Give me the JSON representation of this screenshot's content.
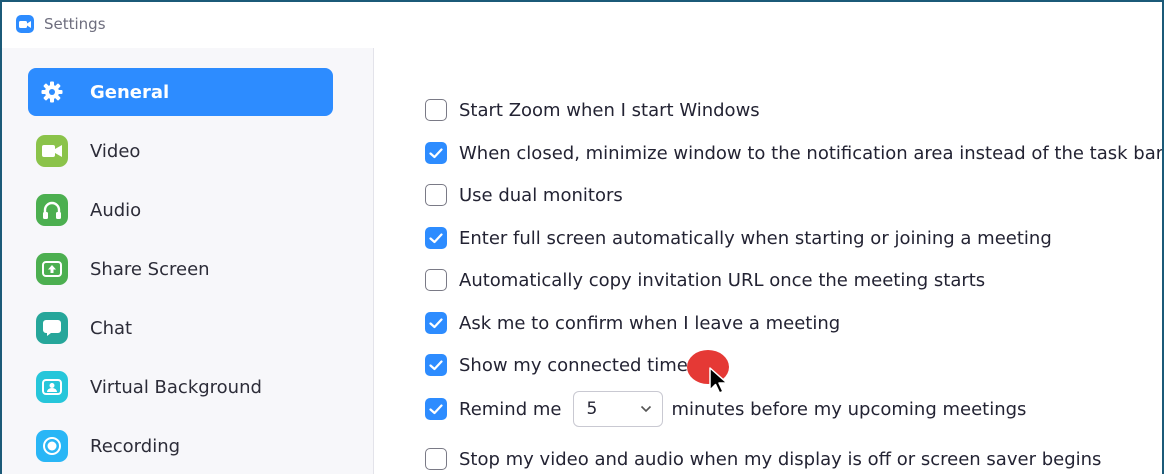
{
  "window": {
    "title": "Settings",
    "icon": "zoom-camera-icon"
  },
  "sidebar": {
    "items": [
      {
        "label": "General",
        "icon": "gear-icon",
        "active": true,
        "color": "#ffffff"
      },
      {
        "label": "Video",
        "icon": "video-camera-icon",
        "color": "#8bc34a"
      },
      {
        "label": "Audio",
        "icon": "headphones-icon",
        "color": "#4caf50"
      },
      {
        "label": "Share Screen",
        "icon": "share-screen-icon",
        "color": "#4caf50"
      },
      {
        "label": "Chat",
        "icon": "chat-bubble-icon",
        "color": "#26a69a"
      },
      {
        "label": "Virtual Background",
        "icon": "virtual-background-icon",
        "color": "#26c6da"
      },
      {
        "label": "Recording",
        "icon": "record-icon",
        "color": "#29b6f6"
      }
    ]
  },
  "options": [
    {
      "label": "Start Zoom when I start Windows",
      "checked": false
    },
    {
      "label": "When closed, minimize window to the notification area instead of the task bar",
      "checked": true
    },
    {
      "label": "Use dual monitors",
      "checked": false
    },
    {
      "label": "Enter full screen automatically when starting or joining a meeting",
      "checked": true
    },
    {
      "label": "Automatically copy invitation URL once the meeting starts",
      "checked": false
    },
    {
      "label": "Ask me to confirm when I leave a meeting",
      "checked": true
    },
    {
      "label": "Show my connected time",
      "checked": true
    },
    {
      "label": "Remind me",
      "suffix": "minutes before my upcoming meetings",
      "checked": true,
      "select_value": "5"
    },
    {
      "label": "Stop my video and audio when my display is off or screen saver begins",
      "checked": false
    }
  ],
  "colors": {
    "accent": "#2d8cff",
    "window_border": "#1b5a78",
    "click_marker": "#e53935"
  }
}
